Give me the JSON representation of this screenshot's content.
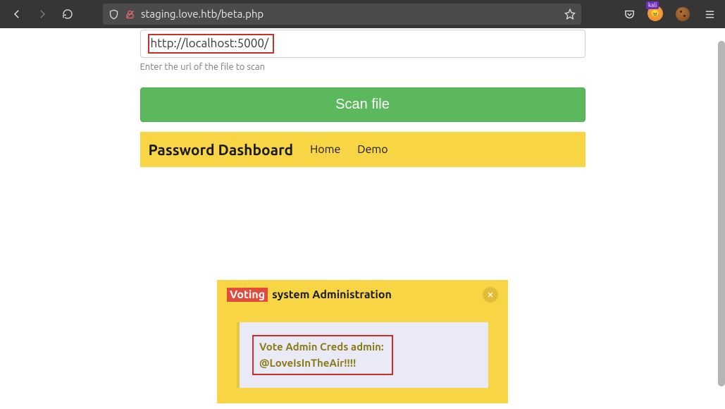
{
  "browser": {
    "url": "staging.love.htb/beta.php"
  },
  "form": {
    "url_value": "http://localhost:5000/",
    "helper": "Enter the url of the file to scan",
    "scan_label": "Scan file"
  },
  "dashboard": {
    "title": "Password Dashboard",
    "links": [
      "Home",
      "Demo"
    ]
  },
  "admin": {
    "tag": "Voting",
    "title_rest": "system Administration",
    "creds_line1": "Vote Admin Creds admin:",
    "creds_line2": "@LoveIsInTheAir!!!!"
  }
}
